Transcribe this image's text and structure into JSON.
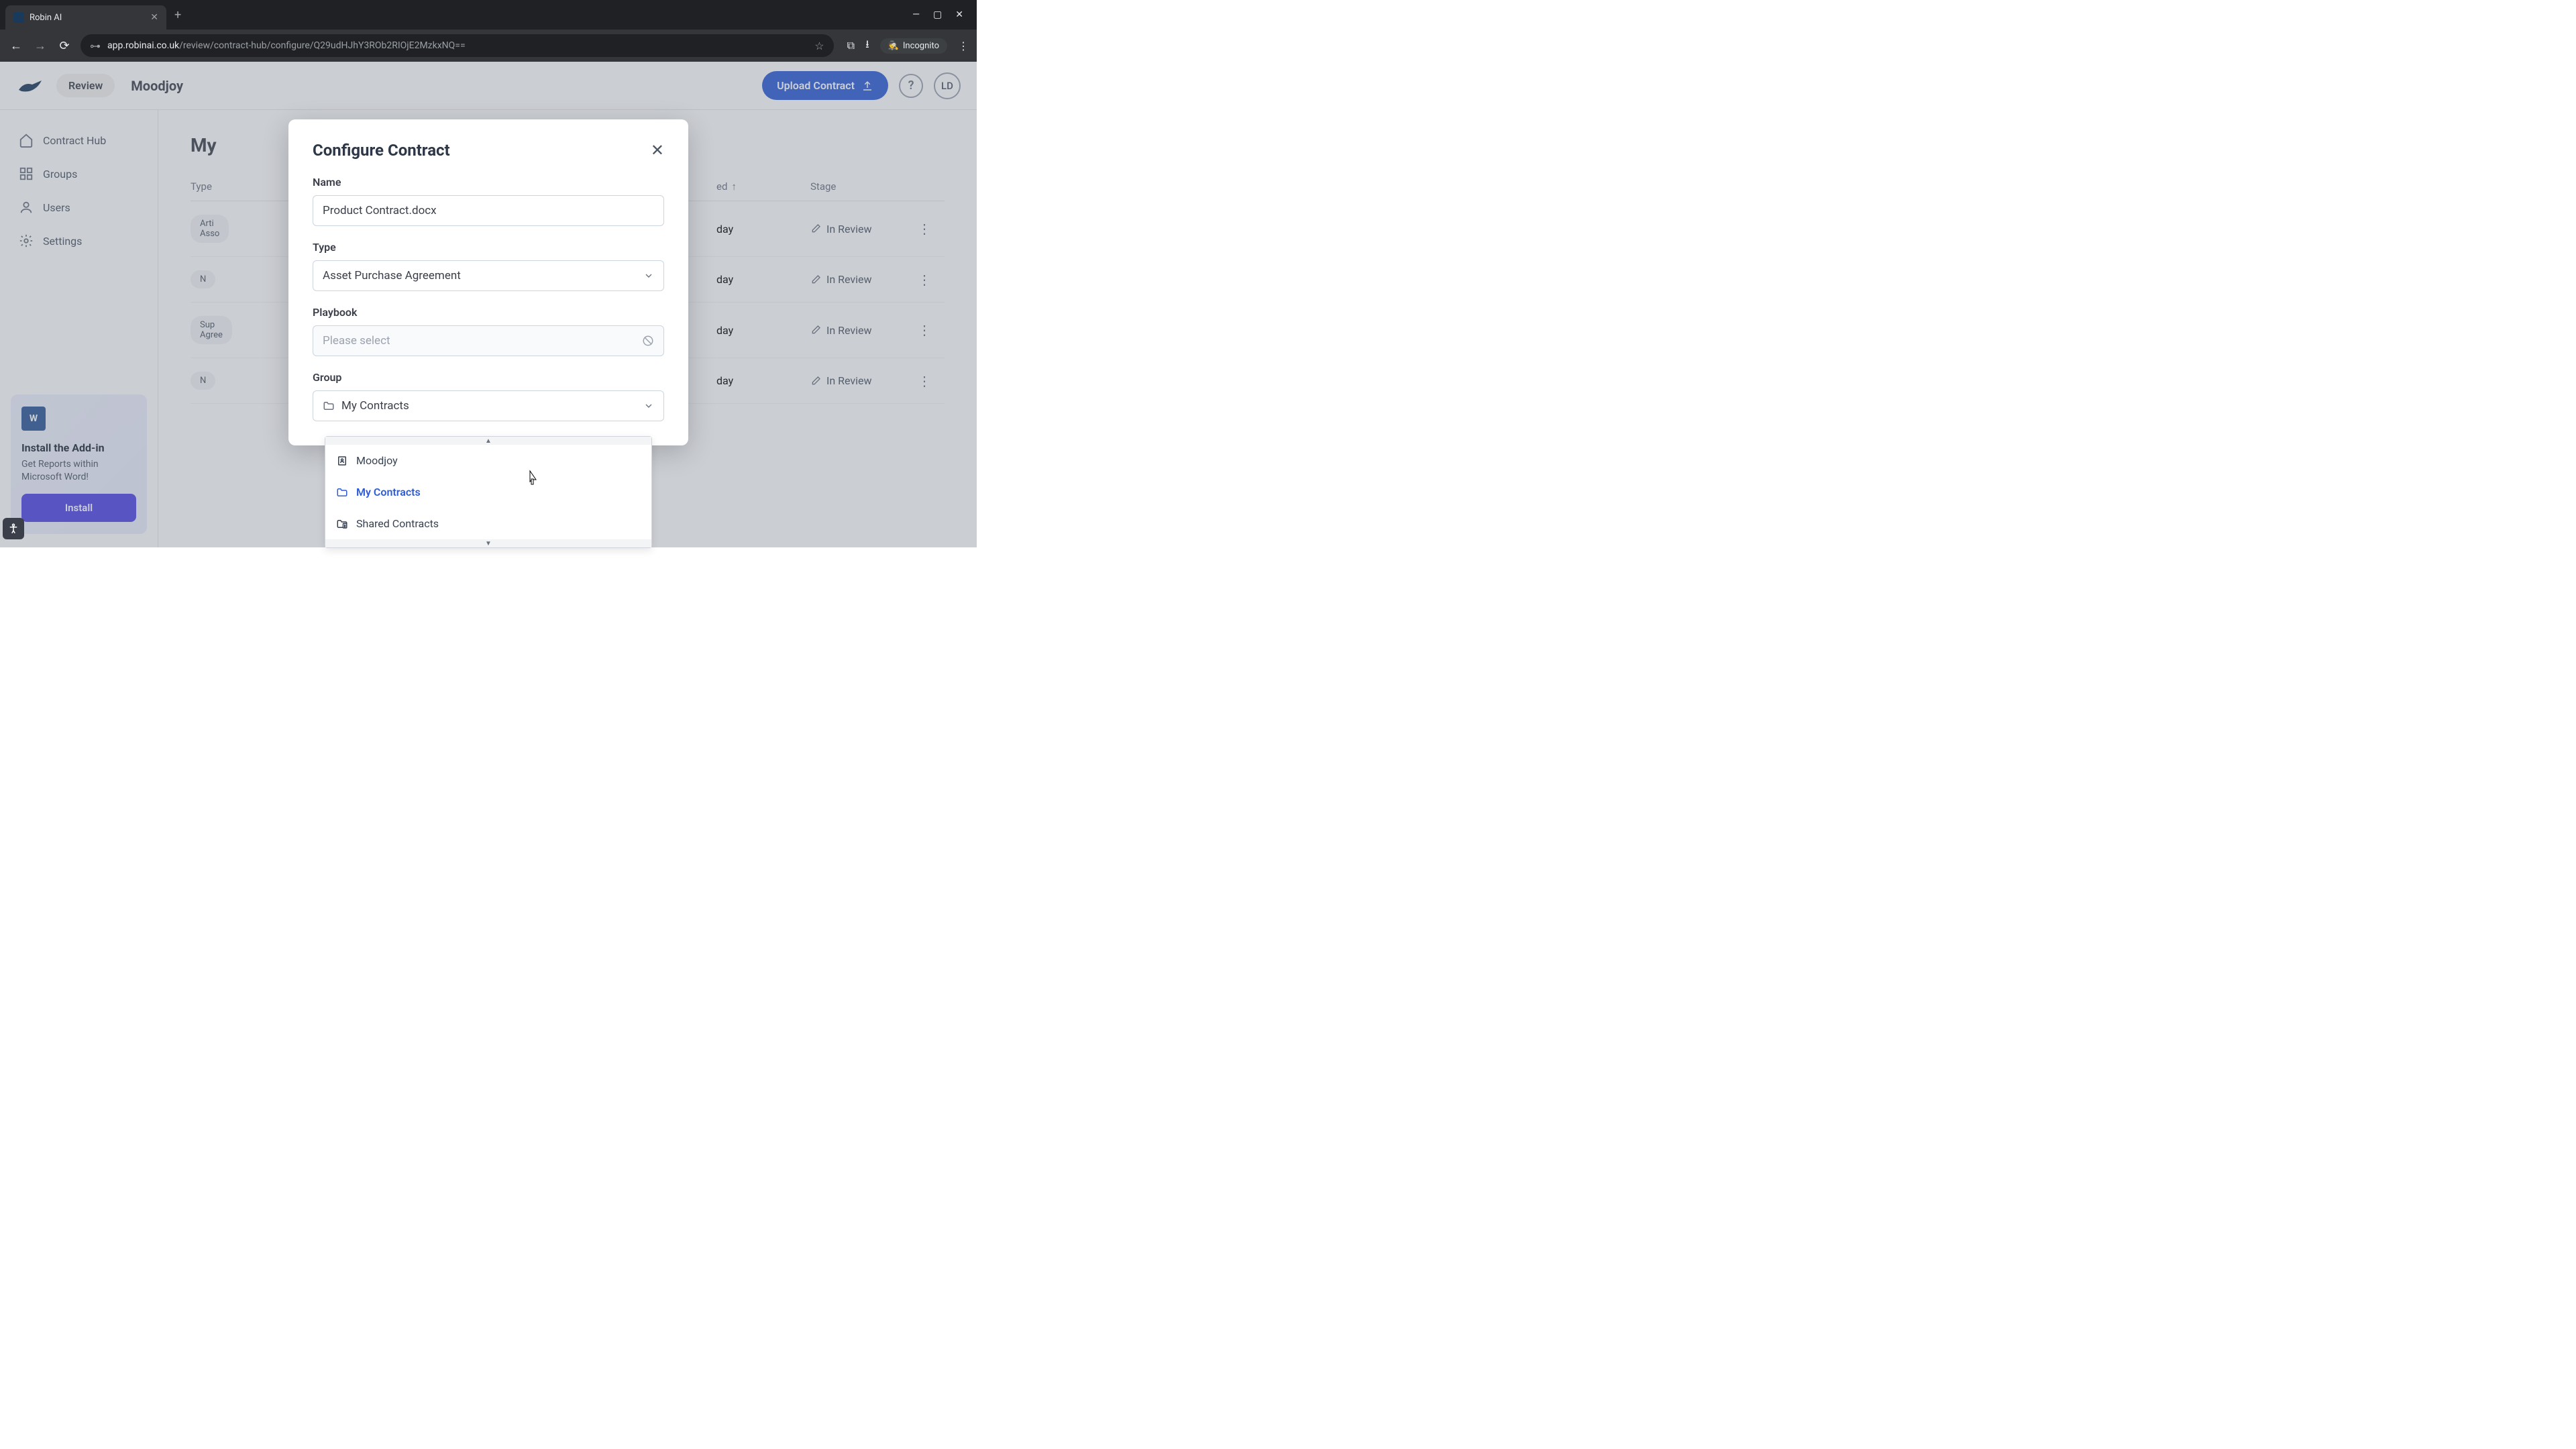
{
  "browser": {
    "tab_title": "Robin AI",
    "url_prefix": "app.robinai.co.uk",
    "url_path": "/review/contract-hub/configure/Q29udHJhY3ROb2RIOjE2MzkxNQ==",
    "incognito_label": "Incognito"
  },
  "header": {
    "review_label": "Review",
    "org_name": "Moodjoy",
    "upload_label": "Upload Contract",
    "avatar_initials": "LD"
  },
  "sidebar": {
    "items": [
      {
        "label": "Contract Hub"
      },
      {
        "label": "Groups"
      },
      {
        "label": "Users"
      },
      {
        "label": "Settings"
      }
    ],
    "addin": {
      "title": "Install the Add-in",
      "desc": "Get Reports within Microsoft Word!",
      "button": "Install"
    }
  },
  "table": {
    "page_title_partial": "My",
    "headers": {
      "type": "Type",
      "uploaded_partial": "ed",
      "stage": "Stage"
    },
    "rows": [
      {
        "type_line1": "Arti",
        "type_line2": "Asso",
        "uploaded": "day",
        "stage": "In Review"
      },
      {
        "type_line1": "N",
        "type_line2": "",
        "uploaded": "day",
        "stage": "In Review"
      },
      {
        "type_line1": "Sup",
        "type_line2": "Agree",
        "uploaded": "day",
        "stage": "In Review"
      },
      {
        "type_line1": "N",
        "type_line2": "",
        "uploaded": "day",
        "stage": "In Review"
      }
    ]
  },
  "modal": {
    "title": "Configure Contract",
    "fields": {
      "name": {
        "label": "Name",
        "value": "Product Contract.docx"
      },
      "type": {
        "label": "Type",
        "value": "Asset Purchase Agreement"
      },
      "playbook": {
        "label": "Playbook",
        "placeholder": "Please select"
      },
      "group": {
        "label": "Group",
        "value": "My Contracts"
      }
    },
    "group_options": [
      {
        "label": "Moodjoy",
        "icon": "org",
        "selected": false
      },
      {
        "label": "My Contracts",
        "icon": "folder",
        "selected": true
      },
      {
        "label": "Shared Contracts",
        "icon": "shared",
        "selected": false
      }
    ]
  }
}
